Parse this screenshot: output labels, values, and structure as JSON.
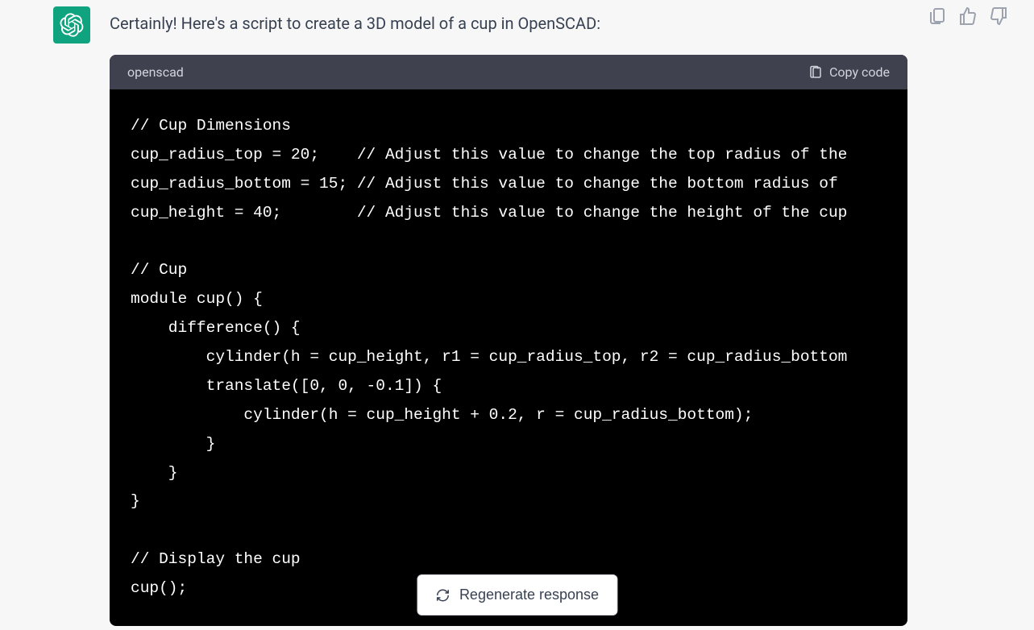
{
  "message": {
    "intro_text": "Certainly! Here's a script to create a 3D model of a cup in OpenSCAD:"
  },
  "codeblock": {
    "language": "openscad",
    "copy_label": "Copy code",
    "code": "// Cup Dimensions\ncup_radius_top = 20;    // Adjust this value to change the top radius of the\ncup_radius_bottom = 15; // Adjust this value to change the bottom radius of \ncup_height = 40;        // Adjust this value to change the height of the cup\n\n// Cup\nmodule cup() {\n    difference() {\n        cylinder(h = cup_height, r1 = cup_radius_top, r2 = cup_radius_bottom\n        translate([0, 0, -0.1]) {\n            cylinder(h = cup_height + 0.2, r = cup_radius_bottom);\n        }\n    }\n}\n\n// Display the cup\ncup();"
  },
  "footer": {
    "regenerate_label": "Regenerate response"
  }
}
